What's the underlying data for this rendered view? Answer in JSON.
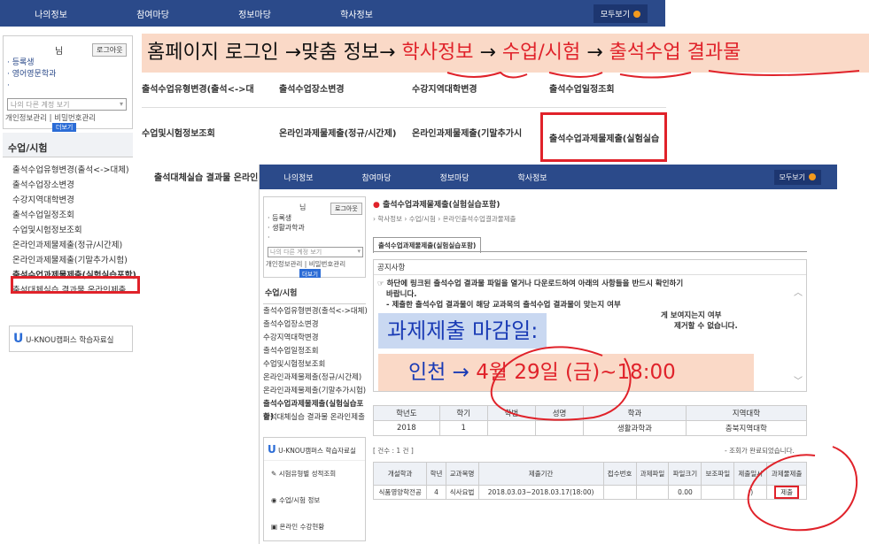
{
  "back": {
    "nav": [
      "나의정보",
      "참여마당",
      "정보마당",
      "학사정보"
    ],
    "nav_all": "모두보기",
    "login": {
      "name_suffix": "님",
      "logout": "로그아웃",
      "lines": [
        "· 등록생",
        "· 영어영문학과",
        "·"
      ],
      "select_placeholder": "나의 다른 계정 보기",
      "links": "개인정보관리 | 비밀번호관리",
      "more": "더보기"
    },
    "side_title": "수업/시험",
    "side_items": [
      "출석수업유형변경(출석<->대체)",
      "출석수업장소변경",
      "수강지역대학변경",
      "출석수업일정조회",
      "수업및시험정보조회",
      "온라인과제물제출(정규/시간제)",
      "온라인과제물제출(기말추가시험)",
      "출석수업과제물제출(실험실습포함)",
      "출석대체실습 결과물 온라인제출"
    ],
    "library_label": "U-KNOU캠퍼스 학습자료실",
    "grid": [
      [
        "출석수업유형변경(출석<->대",
        "출석수업장소변경",
        "수강지역대학변경",
        "출석수업일정조회"
      ],
      [
        "수업및시험정보조회",
        "온라인과제물제출(정규/시간제)",
        "온라인과제물제출(기말추가시",
        "출석수업과제물제출(실험실습"
      ]
    ],
    "grid_row3": "출석대체실습 결과물 온라인"
  },
  "banner": {
    "part1": "홈페이지 로그인 →맞춤 정보→ ",
    "part2": "학사정보",
    "arrow1": " → ",
    "part3": "수업/시험",
    "arrow2": " → ",
    "part4": "출석수업 결과물"
  },
  "front": {
    "nav": [
      "나의정보",
      "참여마당",
      "정보마당",
      "학사정보"
    ],
    "nav_all": "모두보기",
    "login": {
      "name_suffix": "님",
      "logout": "로그아웃",
      "lines": [
        "· 등록생",
        "· 생활과학과",
        "·"
      ],
      "select_placeholder": "나의 다른 계정 보기",
      "links": "개인정보관리 | 비밀번호관리",
      "more": "더보기"
    },
    "page_title": "출석수업과제물제출(실험실습포함)",
    "breadcrumb": "› 학사정보 › 수업/시험 › 온라인출석수업결과물제출",
    "tab": "출석수업과제물제출(실험실습포함)",
    "notice_title": "공지사항",
    "notice_lines": [
      "☞ 하단에 링크된 출석수업 결과물 파일을 열거나 다운로드하여 아래의 사항들을 반드시 확인하기",
      "바랍니다.",
      "- 제출한 출석수업 결과물이 해당 교과목의 출석수업 결과물이 맞는지 여부",
      "게 보여지는지 여부",
      "제거할 수 없습니다."
    ],
    "side_title": "수업/시험",
    "side_items": [
      "출석수업유형변경(출석<->대체)",
      "출석수업장소변경",
      "수강지역대학변경",
      "출석수업일정조회",
      "수업및시험정보조회",
      "온라인과제물제출(정규/시간제)",
      "온라인과제물제출(기말추가시험)",
      "출석수업과제물제출(실험실습포함)",
      "출석대체실습 결과물 온라인제출"
    ],
    "library": [
      {
        "icon": "speaker-icon",
        "label": "U-KNOU캠퍼스 학습자료실"
      },
      {
        "icon": "pen-icon",
        "label": "시험유형별 성적조회"
      },
      {
        "icon": "lamp-icon",
        "label": "수업/시험 정보"
      },
      {
        "icon": "monitor-icon",
        "label": "온라인 수강현황"
      }
    ],
    "info_table": {
      "headers": [
        "학년도",
        "학기",
        "학번",
        "성명",
        "학과",
        "지역대학"
      ],
      "row": [
        "2018",
        "1",
        "",
        "",
        "생활과학과",
        "충북지역대학"
      ]
    },
    "count": "[ 건수 : 1 건 ]",
    "count_right": "- 조회가 완료되었습니다.",
    "list_table": {
      "headers": [
        "개설학과",
        "학년",
        "교과목명",
        "제출기간",
        "접수번호",
        "과제파일",
        "파일크기",
        "보조파일",
        "제출일시",
        "과제물제출"
      ],
      "row": [
        "식품영양학전공",
        "4",
        "식사요법",
        "2018.03.03~2018.03.17(18:00)",
        "",
        "",
        "0.00",
        "",
        "()",
        "제출"
      ]
    }
  },
  "overlay": {
    "deadline_label": "과제제출 마감일:",
    "deadline_p1": "인천 → ",
    "deadline_p2": "4월 29일 (금)",
    "deadline_p3": "~18:00"
  }
}
